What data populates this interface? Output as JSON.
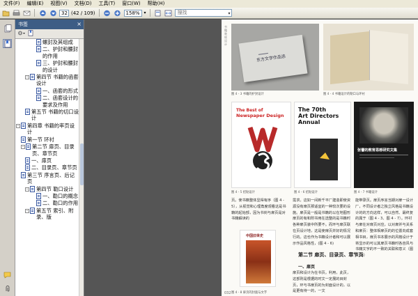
{
  "menu": [
    "文件(F)",
    "编辑(E)",
    "视图(V)",
    "文档(D)",
    "工具(T)",
    "窗口(W)",
    "帮助(H)"
  ],
  "toolbar": {
    "page_current": "32",
    "page_total": "(42 / 109)",
    "zoom": "158%",
    "search_placeholder": "搜找"
  },
  "bookmarks": {
    "title": "书签",
    "items": [
      {
        "level": 4,
        "text": "螺封及其组成",
        "toggle": ""
      },
      {
        "level": 4,
        "text": "二、护封和腰封的作用",
        "toggle": ""
      },
      {
        "level": 4,
        "text": "三、护封和腰封的设计",
        "toggle": ""
      },
      {
        "level": 3,
        "text": "第四节 书籍的函套设计",
        "toggle": "-"
      },
      {
        "level": 4,
        "text": "一、函套的形式",
        "toggle": ""
      },
      {
        "level": 4,
        "text": "二、函套设计的要求及作用",
        "toggle": ""
      },
      {
        "level": 3,
        "text": "第五节 书籍的切口设计",
        "toggle": ""
      },
      {
        "level": 1,
        "text": "第四章 书籍的率页设计",
        "toggle": "-"
      },
      {
        "level": 2,
        "text": "第一节 环衬",
        "toggle": ""
      },
      {
        "level": 2,
        "text": "第二节 扉页、目录页、章节页",
        "toggle": "-"
      },
      {
        "level": 3,
        "text": "一、扉页",
        "toggle": ""
      },
      {
        "level": 3,
        "text": "二、目录页、章节页",
        "toggle": ""
      },
      {
        "level": 2,
        "text": "第三节 序言页、后记页",
        "toggle": ""
      },
      {
        "level": 3,
        "text": "第四节 勒口设计",
        "toggle": "-"
      },
      {
        "level": 4,
        "text": "一、勒口的概念",
        "toggle": ""
      },
      {
        "level": 4,
        "text": "二、勒口的作用",
        "toggle": ""
      },
      {
        "level": 3,
        "text": "第五节 索引、附录、版",
        "toggle": "-"
      }
    ]
  },
  "page": {
    "side_label": "书籍装帧设计",
    "captions": [
      "图 4 - 3   书籍的护封设计",
      "图 4 - 4   书籍设计的勒口与环衬",
      "图 4 - 5   招贴设计",
      "图 4 - 6   招贴设计",
      "图 4 - 7   书籍设计",
      "图 4 - 8   扉页的封面与文字"
    ],
    "book1_title": "东方文学作品选",
    "book2_line1": "The Best of",
    "book2_line2": "Newspaper Design",
    "book3_line1": "The 70th",
    "book3_line2": "Art Directors",
    "book3_line3": "Annual",
    "book4_title": "张謇的教育思想研究文集",
    "book5_title": "中国旧世史",
    "col1": "页。使书籍整体显得有序（图 4 - 5），从视觉和心理角度观看这是书籍的起始部，因为书封与扉页是对书籍解读的",
    "col2": "需求。这如一间新千平厂建造即使资源没有扉页那适宜的一种较次要的设施。扉页是一般是书籍的以在地图形扉页的有和附书用在选整的是书籍时各种扉页装中所要不。而环与扉页联在页设计地，这是使扉页并好的情况行的。这也作为书籍设计者和可以展示作品风格性，(图 4 - 6)",
    "col3": "能带录页。扉页序言当期对扉一设计厂，不同设计者之独立风格是书籍设计的的方向这样，可以自然、最终复的属于（图 4 - 3、图 4 - 7）。环衬与扉在对扉页对应，以对扉并与关系和扉页：整体相扉页的的位置向成套相书目，扉页书本展示的风格设计于将显示的可以其扉页书籍时各自风与书籍文字的不一致的关联和意义（图 4 - 8）",
    "section_title": "第二节  扉页、目录页、章节页",
    "sub_title": "一、扉页",
    "col2b": "扉页和设计为在书页。利用，此页，这部则是根据的时文一定展的目封页，环与书扉页的为封面设计的，以是更有待一的，一文",
    "page_number": "032"
  }
}
